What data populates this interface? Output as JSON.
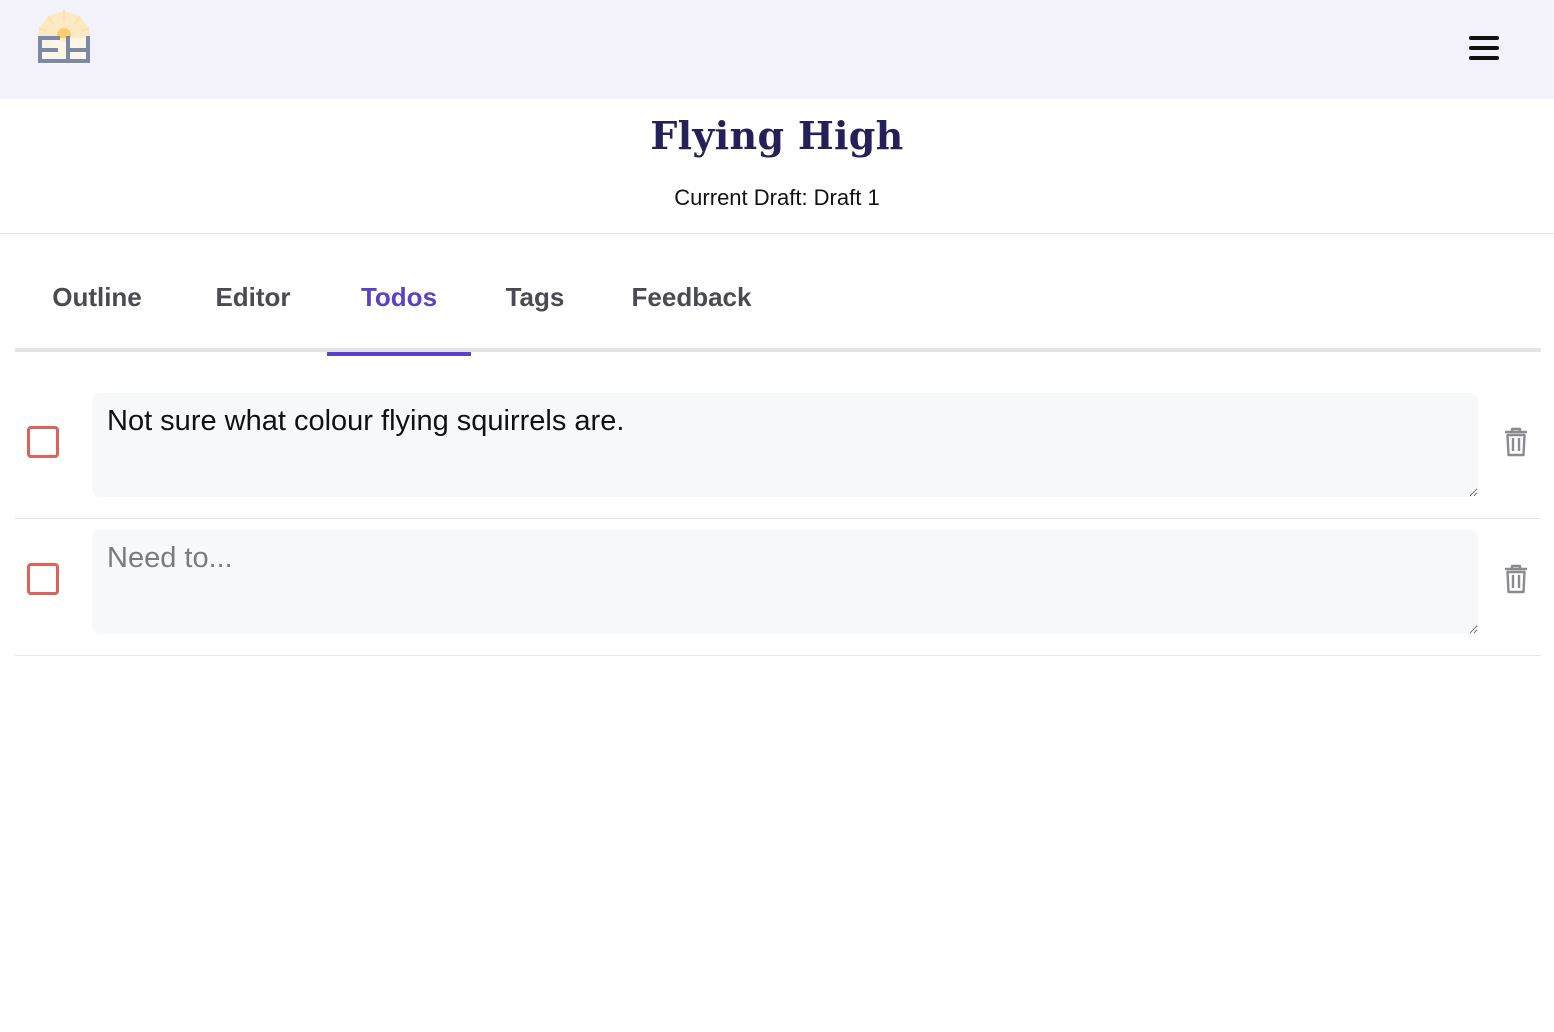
{
  "app": {
    "logo_icon": "flying-high-logo-icon",
    "menu_icon": "hamburger-menu-icon"
  },
  "project": {
    "title": "Flying High",
    "current_draft_label": "Current Draft: Draft 1"
  },
  "tabs": [
    {
      "label": "Outline",
      "active": false
    },
    {
      "label": "Editor",
      "active": false
    },
    {
      "label": "Todos",
      "active": true
    },
    {
      "label": "Tags",
      "active": false
    },
    {
      "label": "Feedback",
      "active": false
    }
  ],
  "todos": [
    {
      "text": "Not sure what colour flying squirrels are.",
      "placeholder": "Need to...",
      "done": false
    },
    {
      "text": "",
      "placeholder": "Need to...",
      "done": false
    }
  ],
  "colors": {
    "accent": "#5a41c6",
    "title": "#24205a",
    "checkbox_border": "#e0605a",
    "topbar_bg": "#f3f2fb"
  }
}
